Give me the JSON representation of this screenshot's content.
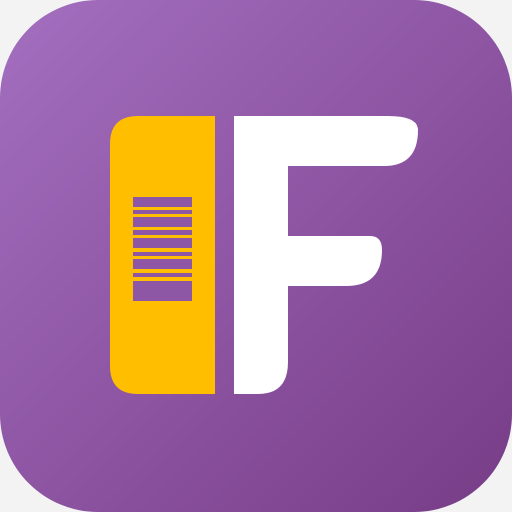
{
  "app_icon": {
    "icon_name": "letter-f-barcode-app-icon",
    "colors": {
      "background_gradient_start": "#a46fc0",
      "background_gradient_end": "#773c86",
      "barcode_panel": "#ffbf00",
      "letter": "#ffffff",
      "barcode_lines": "#8d57a6"
    }
  }
}
